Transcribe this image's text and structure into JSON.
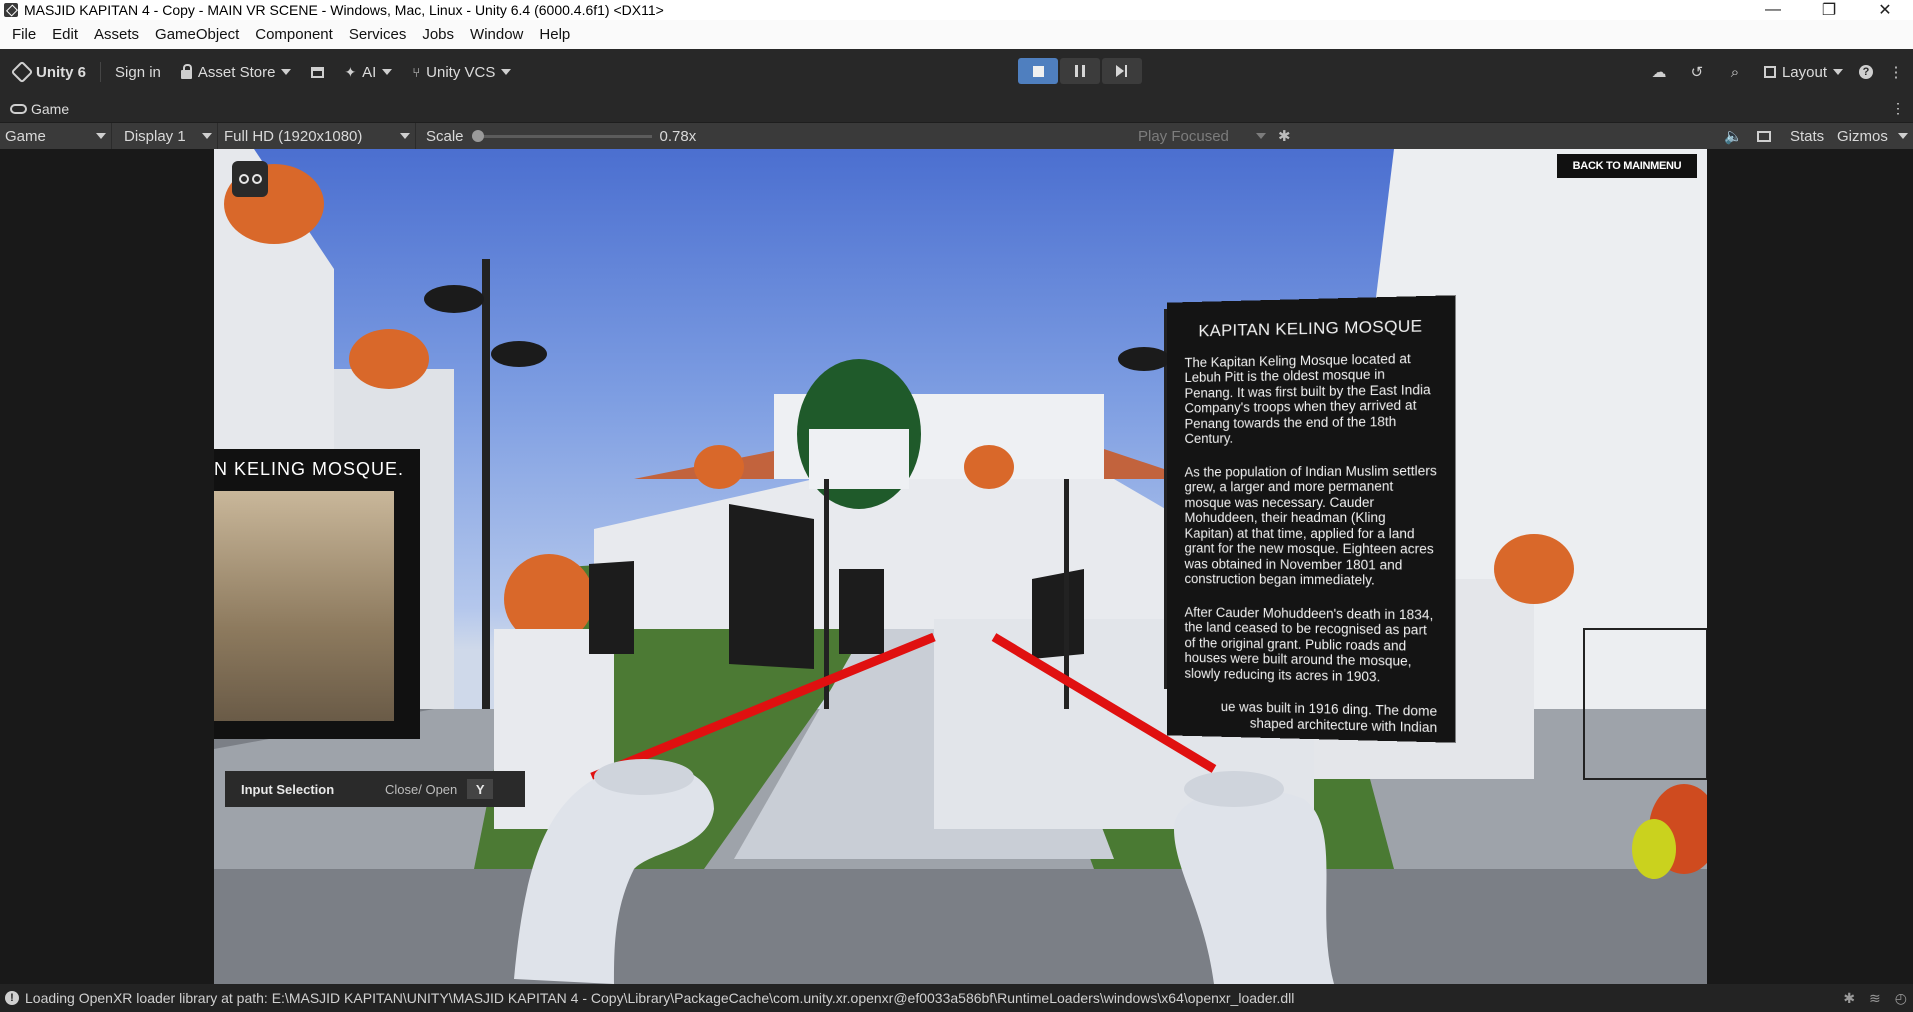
{
  "window": {
    "title": "MASJID KAPITAN 4 - Copy - MAIN VR SCENE - Windows, Mac, Linux - Unity 6.4 (6000.4.6f1) <DX11>",
    "minimize": "—",
    "maximize": "❐",
    "close": "✕"
  },
  "menu": [
    "File",
    "Edit",
    "Assets",
    "GameObject",
    "Component",
    "Services",
    "Jobs",
    "Window",
    "Help"
  ],
  "toolbar": {
    "unity": "Unity 6",
    "sign_in": "Sign in",
    "asset_store": "Asset Store",
    "ai": "AI",
    "vcs": "Unity VCS",
    "layout": "Layout"
  },
  "game_tab": {
    "label": "Game"
  },
  "game_bar": {
    "mode": "Game",
    "display": "Display 1",
    "resolution": "Full HD (1920x1080)",
    "scale_label": "Scale",
    "scale_value": "0.78x",
    "play_focused": "Play Focused",
    "stats": "Stats",
    "gizmos": "Gizmos"
  },
  "scene": {
    "back_button": "BACK TO MAINMENU",
    "left_panel_title": "N KELING MOSQUE.",
    "info_panel": {
      "title": "KAPITAN KELING MOSQUE",
      "p1": "The Kapitan Keling Mosque located at Lebuh Pitt is the oldest mosque in Penang. It was first built by the East India Company's troops when they arrived at Penang towards the end of the 18th Century.",
      "p2": "As the population of Indian Muslim settlers grew, a larger and more permanent mosque was necessary. Cauder Mohuddeen, their headman (Kling Kapitan) at that time, applied for a land grant for the new mosque. Eighteen acres was obtained in November 1801 and construction began immediately.",
      "p3": "After Cauder Mohuddeen's death in 1834, the land ceased to be recognised as part of the original grant. Public roads and houses were built around the mosque, slowly reducing its acres in 1903.",
      "p4": "ue was built in 1916 ding. The dome shaped architecture with Indian"
    },
    "input_selection": {
      "title": "Input Selection",
      "hint": "Close/ Open",
      "key": "Y"
    }
  },
  "status": {
    "message": "Loading OpenXR loader library at path: E:\\MASJID KAPITAN\\UNITY\\MASJID KAPITAN 4 - Copy\\Library\\PackageCache\\com.unity.xr.openxr@ef0033a586bf\\RuntimeLoaders\\windows\\x64\\openxr_loader.dll"
  },
  "colors": {
    "play_active": "#4f7fbf",
    "dome_green": "#1f5a2a",
    "dome_orange": "#d9682a",
    "laser_red": "#e01010"
  }
}
